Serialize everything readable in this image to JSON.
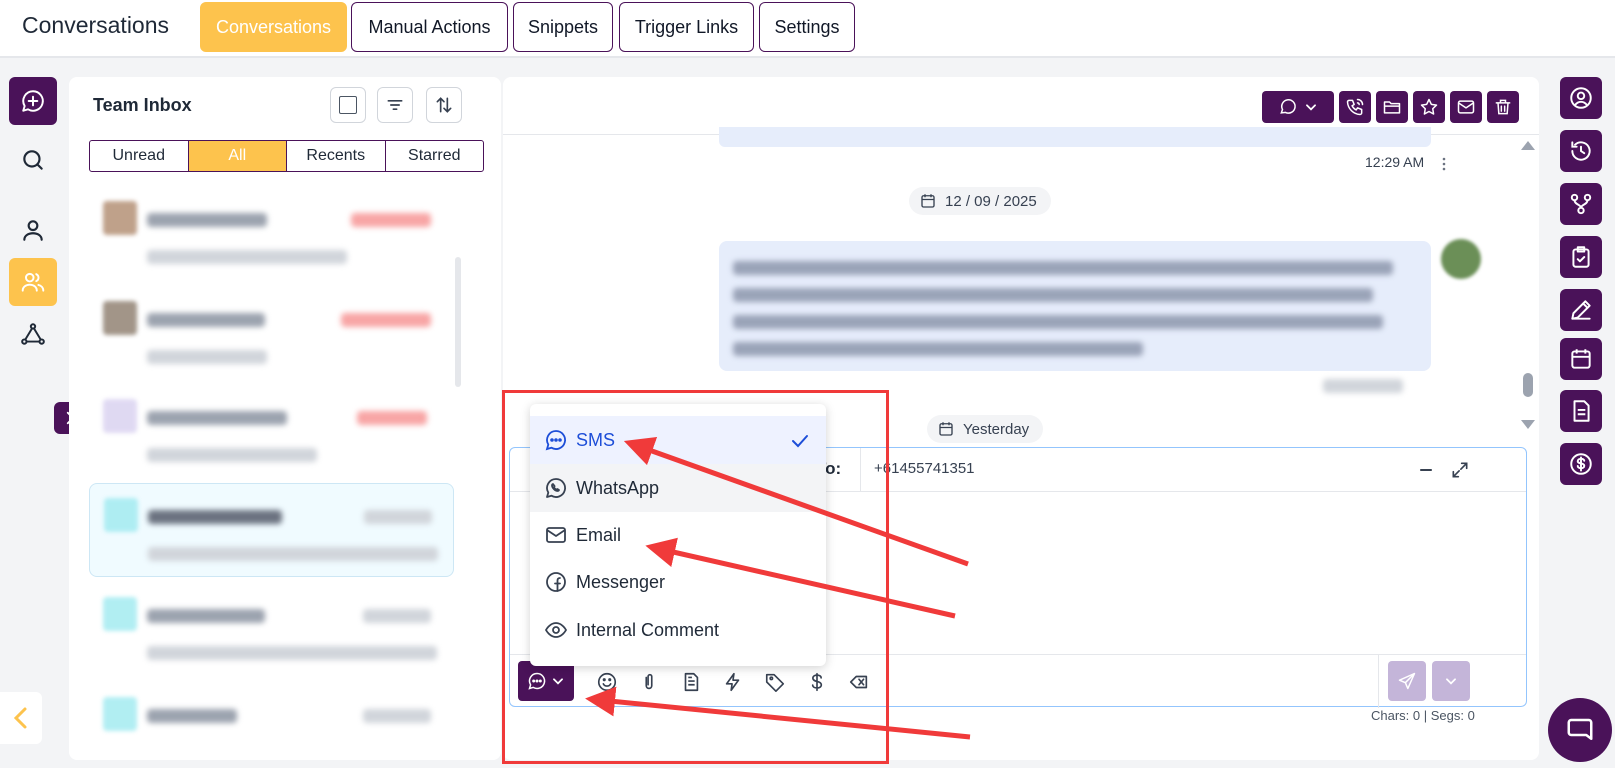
{
  "header": {
    "app_title": "Conversations",
    "tabs": [
      {
        "label": "Conversations",
        "active": true
      },
      {
        "label": "Manual Actions",
        "active": false
      },
      {
        "label": "Snippets",
        "active": false
      },
      {
        "label": "Trigger Links",
        "active": false
      },
      {
        "label": "Settings",
        "active": false
      }
    ]
  },
  "left_rail": {
    "items": [
      "new-chat-icon",
      "search-icon",
      "contact-icon",
      "team-icon",
      "workflow-icon"
    ],
    "active": "team-icon"
  },
  "inbox": {
    "title": "Team Inbox",
    "filter_tabs": [
      {
        "label": "Unread",
        "active": false
      },
      {
        "label": "All",
        "active": true
      },
      {
        "label": "Recents",
        "active": false
      },
      {
        "label": "Starred",
        "active": false
      }
    ],
    "conversations_count_visible": 6
  },
  "chat": {
    "header_buttons": [
      "chat-type-icon",
      "call-icon",
      "folder-icon",
      "star-icon",
      "mail-icon",
      "trash-icon"
    ],
    "message_time": "12:29 AM",
    "date_separators": [
      "12 / 09 / 2025",
      "Yesterday"
    ]
  },
  "composer": {
    "to_label": "To:",
    "to_number": "+61455741351",
    "chars_text": "Chars: 0 | Segs: 0"
  },
  "channel_menu": {
    "items": [
      {
        "label": "SMS",
        "icon": "sms-icon",
        "selected": true
      },
      {
        "label": "WhatsApp",
        "icon": "whatsapp-icon",
        "selected": false
      },
      {
        "label": "Email",
        "icon": "email-icon",
        "selected": false
      },
      {
        "label": "Messenger",
        "icon": "messenger-icon",
        "selected": false
      },
      {
        "label": "Internal Comment",
        "icon": "eye-icon",
        "selected": false
      }
    ]
  },
  "right_rail": {
    "items": [
      "user-circle-icon",
      "history-icon",
      "branch-icon",
      "clipboard-check-icon",
      "pen-icon",
      "calendar-icon",
      "document-icon",
      "dollar-icon"
    ]
  },
  "colors": {
    "accent_purple": "#4a1259",
    "accent_yellow": "#fdc34d",
    "annotation_red": "#f03a3a"
  }
}
